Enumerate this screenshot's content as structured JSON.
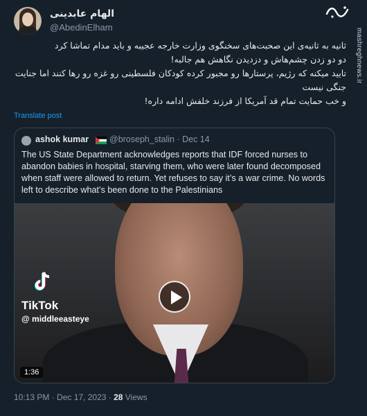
{
  "author": {
    "display_name": "الهام عابدینی",
    "handle": "@AbedinElham"
  },
  "brand": {
    "logo_alt": "mashregh logo",
    "watermark": "mashreghnews.ir"
  },
  "tweet": {
    "lines": [
      "ثانیه به ثانیه‌ی این صحبت‌های سخنگوی وزارت خارجه عجیبه و باید مدام تماشا کرد",
      "دو دو زدن چشم‌هاش و دزدیدن نگاهش هم جالبه!",
      "تایید میکنه که رژیم، پرستارها رو مجبور کرده کودکان فلسطینی رو غزه رو رها کنند اما جنایت جنگی نیست",
      "و خب حمایت تمام قد آمریکا از فرزند خلفش ادامه داره!"
    ],
    "translate_label": "Translate post"
  },
  "quote": {
    "name": "ashok kumar",
    "handle_date": "@broseph_stalin · Dec 14",
    "text": "The US State Department acknowledges reports that IDF forced nurses to abandon babies in hospital, starving them, who were later found decomposed when staff were allowed to return. Yet refuses to say it’s a war crime. No words left to describe what’s been done to the Palestinians",
    "video": {
      "tiktok_word": "TikTok",
      "tiktok_handle": "@ middleeasteye",
      "duration": "1:36"
    }
  },
  "footer": {
    "timestamp": "10:13 PM · Dec 17, 2023 · ",
    "views_count": "28",
    "views_label": " Views"
  },
  "colors": {
    "background": "#15202b",
    "accent": "#1d9bf0",
    "muted": "#8b98a5"
  }
}
